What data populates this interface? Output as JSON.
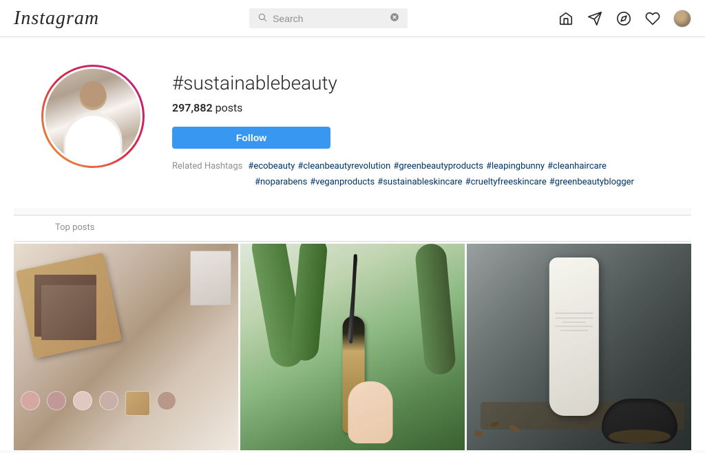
{
  "header": {
    "logo": "Instagram",
    "search_placeholder": "Search",
    "nav_icons": [
      "home",
      "send",
      "compass",
      "heart",
      "profile"
    ]
  },
  "profile": {
    "handle": "#sustainablebeauty",
    "posts_count": "297,882",
    "posts_label": "posts",
    "follow_label": "Follow",
    "related_label": "Related Hashtags",
    "hashtags": [
      "#ecobeauty",
      "#cleanbeautyrevolution",
      "#greenbeautyproducts",
      "#leapingbunny",
      "#cleanhaircare",
      "#noparabens",
      "#veganproducts",
      "#sustainableskincare",
      "#crueltyfreeskincare",
      "#greenbeautyblogger"
    ]
  },
  "top_posts": {
    "label": "Top posts"
  }
}
